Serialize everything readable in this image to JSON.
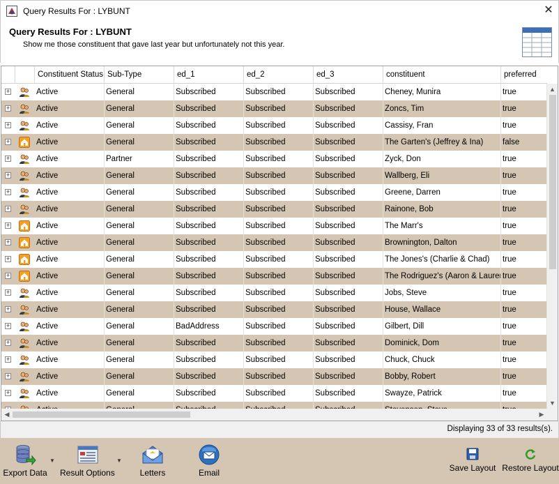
{
  "window": {
    "title": "Query Results For : LYBUNT",
    "close_glyph": "✕"
  },
  "header": {
    "title": "Query Results For : LYBUNT",
    "description": "Show me those constituent that gave last year but unfortunately not this year."
  },
  "columns": [
    "Constituent Status",
    "Sub-Type",
    "ed_1",
    "ed_2",
    "ed_3",
    "constituent",
    "preferred"
  ],
  "rows": [
    {
      "icon": "person-icon",
      "status": "Active",
      "subtype": "General",
      "ed1": "Subscribed",
      "ed2": "Subscribed",
      "ed3": "Subscribed",
      "constituent": "Cheney, Munira",
      "preferred": "true"
    },
    {
      "icon": "person-icon",
      "status": "Active",
      "subtype": "General",
      "ed1": "Subscribed",
      "ed2": "Subscribed",
      "ed3": "Subscribed",
      "constituent": "Zoncs, Tim",
      "preferred": "true"
    },
    {
      "icon": "person-icon",
      "status": "Active",
      "subtype": "General",
      "ed1": "Subscribed",
      "ed2": "Subscribed",
      "ed3": "Subscribed",
      "constituent": "Cassisy, Fran",
      "preferred": "true"
    },
    {
      "icon": "house-icon",
      "status": "Active",
      "subtype": "General",
      "ed1": "Subscribed",
      "ed2": "Subscribed",
      "ed3": "Subscribed",
      "constituent": "The Garten's (Jeffrey & Ina)",
      "preferred": "false"
    },
    {
      "icon": "person-icon",
      "status": "Active",
      "subtype": "Partner",
      "ed1": "Subscribed",
      "ed2": "Subscribed",
      "ed3": "Subscribed",
      "constituent": "Zyck, Don",
      "preferred": "true"
    },
    {
      "icon": "person-icon",
      "status": "Active",
      "subtype": "General",
      "ed1": "Subscribed",
      "ed2": "Subscribed",
      "ed3": "Subscribed",
      "constituent": "Wallberg, Eli",
      "preferred": "true"
    },
    {
      "icon": "person-icon",
      "status": "Active",
      "subtype": "General",
      "ed1": "Subscribed",
      "ed2": "Subscribed",
      "ed3": "Subscribed",
      "constituent": "Greene, Darren",
      "preferred": "true"
    },
    {
      "icon": "person-icon",
      "status": "Active",
      "subtype": "General",
      "ed1": "Subscribed",
      "ed2": "Subscribed",
      "ed3": "Subscribed",
      "constituent": "Rainone, Bob",
      "preferred": "true"
    },
    {
      "icon": "house-icon",
      "status": "Active",
      "subtype": "General",
      "ed1": "Subscribed",
      "ed2": "Subscribed",
      "ed3": "Subscribed",
      "constituent": "The Marr's",
      "preferred": "true"
    },
    {
      "icon": "house-icon",
      "status": "Active",
      "subtype": "General",
      "ed1": "Subscribed",
      "ed2": "Subscribed",
      "ed3": "Subscribed",
      "constituent": "Brownington, Dalton",
      "preferred": "true"
    },
    {
      "icon": "house-icon",
      "status": "Active",
      "subtype": "General",
      "ed1": "Subscribed",
      "ed2": "Subscribed",
      "ed3": "Subscribed",
      "constituent": "The Jones's (Charlie & Chad)",
      "preferred": "true"
    },
    {
      "icon": "house-icon",
      "status": "Active",
      "subtype": "General",
      "ed1": "Subscribed",
      "ed2": "Subscribed",
      "ed3": "Subscribed",
      "constituent": "The Rodriguez's (Aaron & Lauren)",
      "preferred": "true"
    },
    {
      "icon": "person-icon",
      "status": "Active",
      "subtype": "General",
      "ed1": "Subscribed",
      "ed2": "Subscribed",
      "ed3": "Subscribed",
      "constituent": "Jobs, Steve",
      "preferred": "true"
    },
    {
      "icon": "person-icon",
      "status": "Active",
      "subtype": "General",
      "ed1": "Subscribed",
      "ed2": "Subscribed",
      "ed3": "Subscribed",
      "constituent": "House, Wallace",
      "preferred": "true"
    },
    {
      "icon": "person-icon",
      "status": "Active",
      "subtype": "General",
      "ed1": "BadAddress",
      "ed2": "Subscribed",
      "ed3": "Subscribed",
      "constituent": "Gilbert, Dill",
      "preferred": "true"
    },
    {
      "icon": "person-icon",
      "status": "Active",
      "subtype": "General",
      "ed1": "Subscribed",
      "ed2": "Subscribed",
      "ed3": "Subscribed",
      "constituent": "Dominick, Dom",
      "preferred": "true"
    },
    {
      "icon": "person-icon",
      "status": "Active",
      "subtype": "General",
      "ed1": "Subscribed",
      "ed2": "Subscribed",
      "ed3": "Subscribed",
      "constituent": "Chuck, Chuck",
      "preferred": "true"
    },
    {
      "icon": "person-icon",
      "status": "Active",
      "subtype": "General",
      "ed1": "Subscribed",
      "ed2": "Subscribed",
      "ed3": "Subscribed",
      "constituent": "Bobby, Robert",
      "preferred": "true"
    },
    {
      "icon": "person-icon",
      "status": "Active",
      "subtype": "General",
      "ed1": "Subscribed",
      "ed2": "Subscribed",
      "ed3": "Subscribed",
      "constituent": "Swayze, Patrick",
      "preferred": "true"
    },
    {
      "icon": "person-icon",
      "status": "Active",
      "subtype": "General",
      "ed1": "Subscribed",
      "ed2": "Subscribed",
      "ed3": "Subscribed",
      "constituent": "Stevenson, Steve",
      "preferred": "true"
    }
  ],
  "status": {
    "text": "Displaying 33 of 33 results(s)."
  },
  "toolbar": {
    "export_label": "Export Data",
    "result_options_label": "Result Options",
    "letters_label": "Letters",
    "email_label": "Email",
    "save_layout_label": "Save Layout",
    "restore_layout_label": "Restore Layout"
  },
  "colors": {
    "alt_row": "#d5c6b3",
    "toolbar_bg": "#d5c6b3"
  }
}
